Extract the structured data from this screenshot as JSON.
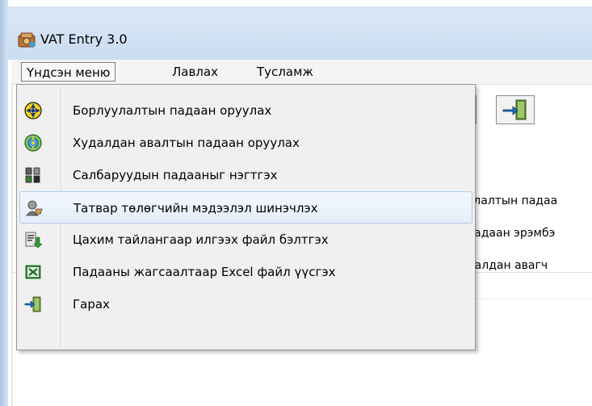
{
  "window": {
    "title": "VAT Entry 3.0"
  },
  "menubar": {
    "items": [
      {
        "label": "Үндсэн меню"
      },
      {
        "label": "Лавлах"
      },
      {
        "label": "Тусламж"
      }
    ]
  },
  "dropdown": {
    "items": [
      {
        "label": "Борлуулалтын падаан оруулах",
        "icon": "sales-invoice-icon"
      },
      {
        "label": "Худалдан авалтын падаан оруулах",
        "icon": "purchase-invoice-icon"
      },
      {
        "label": "Салбаруудын падааныг нэгтгэх",
        "icon": "merge-branches-icon"
      },
      {
        "label": "Татвар төлөгчийн мэдээлэл шинэчлэх",
        "icon": "taxpayer-update-icon"
      },
      {
        "label": "Цахим тайлангаар илгээх файл бэлтгэх",
        "icon": "export-report-icon"
      },
      {
        "label": "Падааны жагсаалтаар Excel файл үүсгэх",
        "icon": "excel-icon"
      },
      {
        "label": "Гарах",
        "icon": "exit-icon"
      }
    ]
  },
  "background": {
    "texts": [
      "улалтын падаа",
      "падаан эрэмбэ",
      "далдан авагч"
    ]
  },
  "colors": {
    "titlebar": "#c9dcf1",
    "menu_hover": "#e4eefa",
    "menu_hover_border": "#aecbe9",
    "dropdown_bg": "#f0f0f0"
  }
}
